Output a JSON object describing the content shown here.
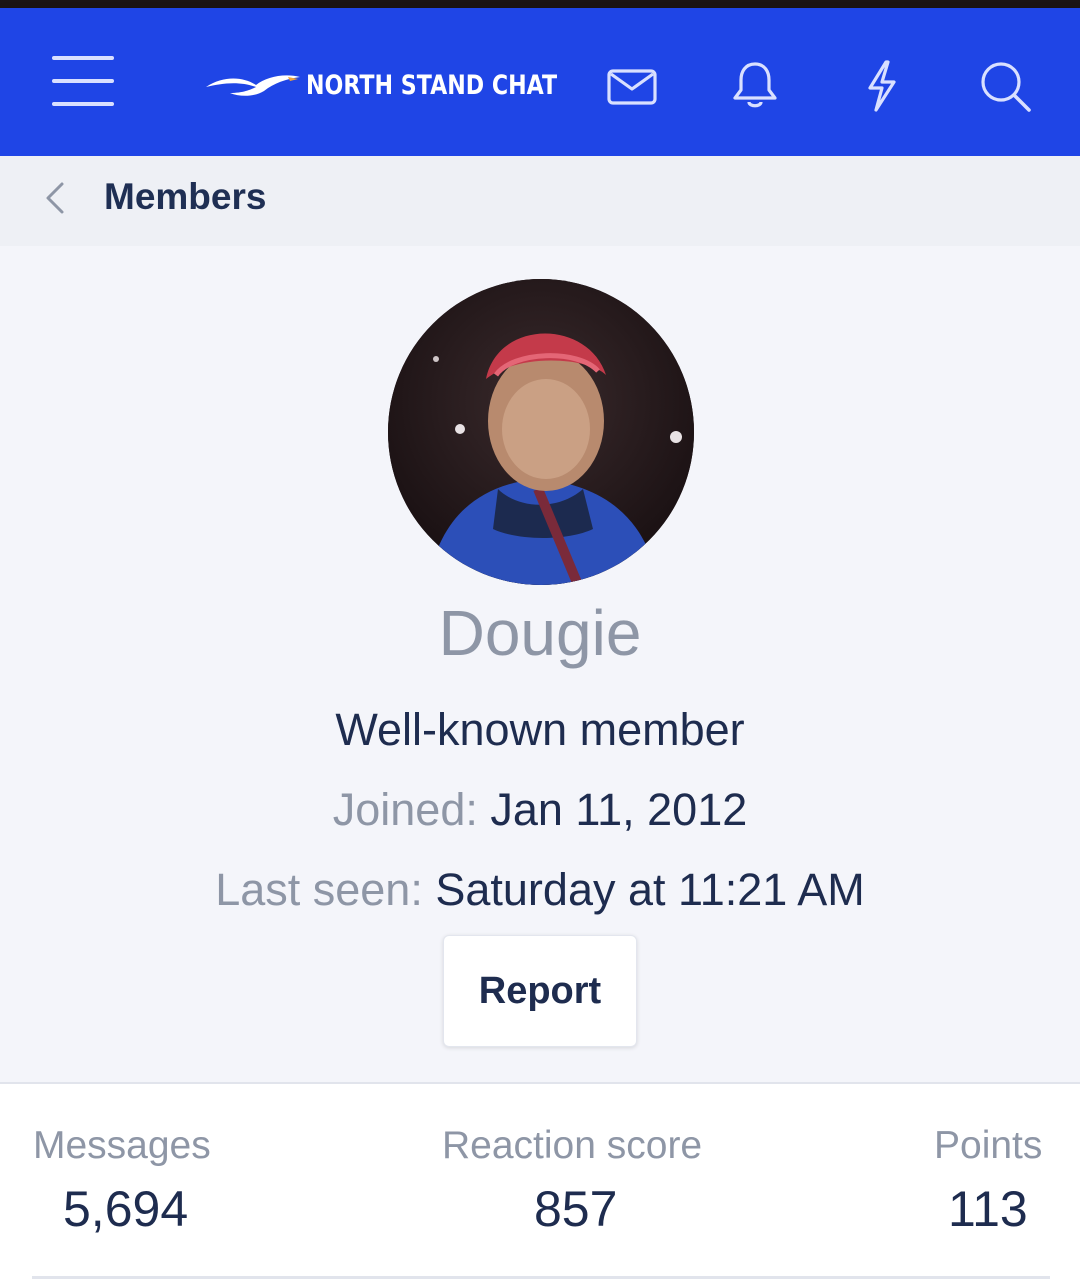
{
  "header": {
    "logo_text": "NORTH STAND CHAT",
    "icons": [
      "menu-icon",
      "envelope-icon",
      "bell-icon",
      "lightning-icon",
      "search-icon"
    ],
    "background_color": "#1f45e6"
  },
  "breadcrumb": {
    "label": "Members",
    "back_icon": "chevron-left-icon"
  },
  "profile": {
    "username": "Dougie",
    "user_title": "Well-known member",
    "joined_label": "Joined:",
    "joined_value": "Jan 11, 2012",
    "last_seen_label": "Last seen:",
    "last_seen_value": "Saturday at 11:21 AM",
    "report_label": "Report"
  },
  "stats": [
    {
      "label": "Messages",
      "value": "5,694"
    },
    {
      "label": "Reaction score",
      "value": "857"
    },
    {
      "label": "Points",
      "value": "113"
    }
  ],
  "colors": {
    "accent": "#1f45e6",
    "text_dark": "#1e2c4f",
    "text_muted": "#8e96a6"
  }
}
